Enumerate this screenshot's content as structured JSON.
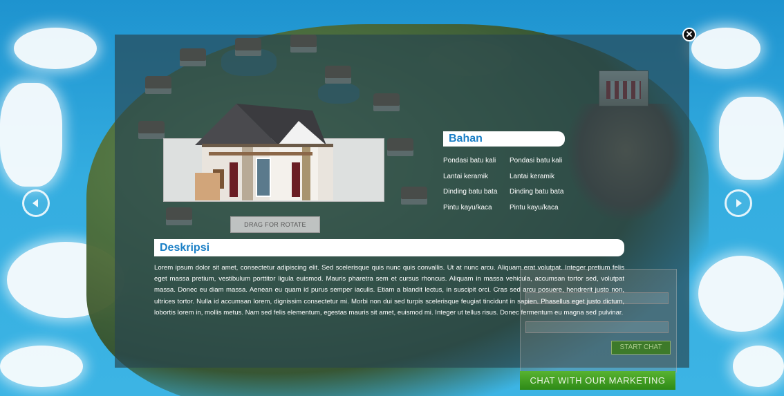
{
  "dialog": {
    "close_symbol": "✕",
    "drag_label": "DRAG FOR ROTATE"
  },
  "bahan": {
    "title": "Bahan",
    "col1": [
      "Pondasi batu kali",
      "Lantai keramik",
      "Dinding batu bata",
      "Pintu kayu/kaca"
    ],
    "col2": [
      "Pondasi batu kali",
      "Lantai keramik",
      "Dinding batu bata",
      "Pintu kayu/kaca"
    ]
  },
  "deskripsi": {
    "title": "Deskripsi",
    "text": "Lorem ipsum dolor sit amet, consectetur adipiscing elit. Sed scelerisque quis nunc quis convallis. Ut at nunc arcu. Aliquam erat volutpat. Integer pretium felis eget massa pretium, vestibulum porttitor ligula euismod. Mauris pharetra sem et cursus rhoncus. Aliquam in massa vehicula, accumsan tortor sed, volutpat massa. Donec eu diam massa. Aenean eu quam id purus semper iaculis. Etiam a blandit lectus, in suscipit orci. Cras sed arcu posuere, hendrerit justo non, ultrices tortor. Nulla id accumsan lorem, dignissim consectetur mi. Morbi non dui sed turpis scelerisque feugiat tincidunt in sapien. Phasellus eget justo dictum, lobortis lorem in, mollis metus. Nam sed felis elementum, egestas mauris sit amet, euismod mi. Integer ut tellus risus. Donec fermentum eu magna sed pulvinar."
  },
  "chat": {
    "start_label": "START CHAT",
    "bar_label": "CHAT WITH OUR MARKETING"
  },
  "icons": {
    "prev": "chevron-left-icon",
    "next": "chevron-right-icon",
    "close": "close-icon"
  },
  "colors": {
    "heading": "#1a7fc6",
    "chat_bar": "#3d9a22",
    "overlay": "rgba(40,70,80,0.68)"
  }
}
